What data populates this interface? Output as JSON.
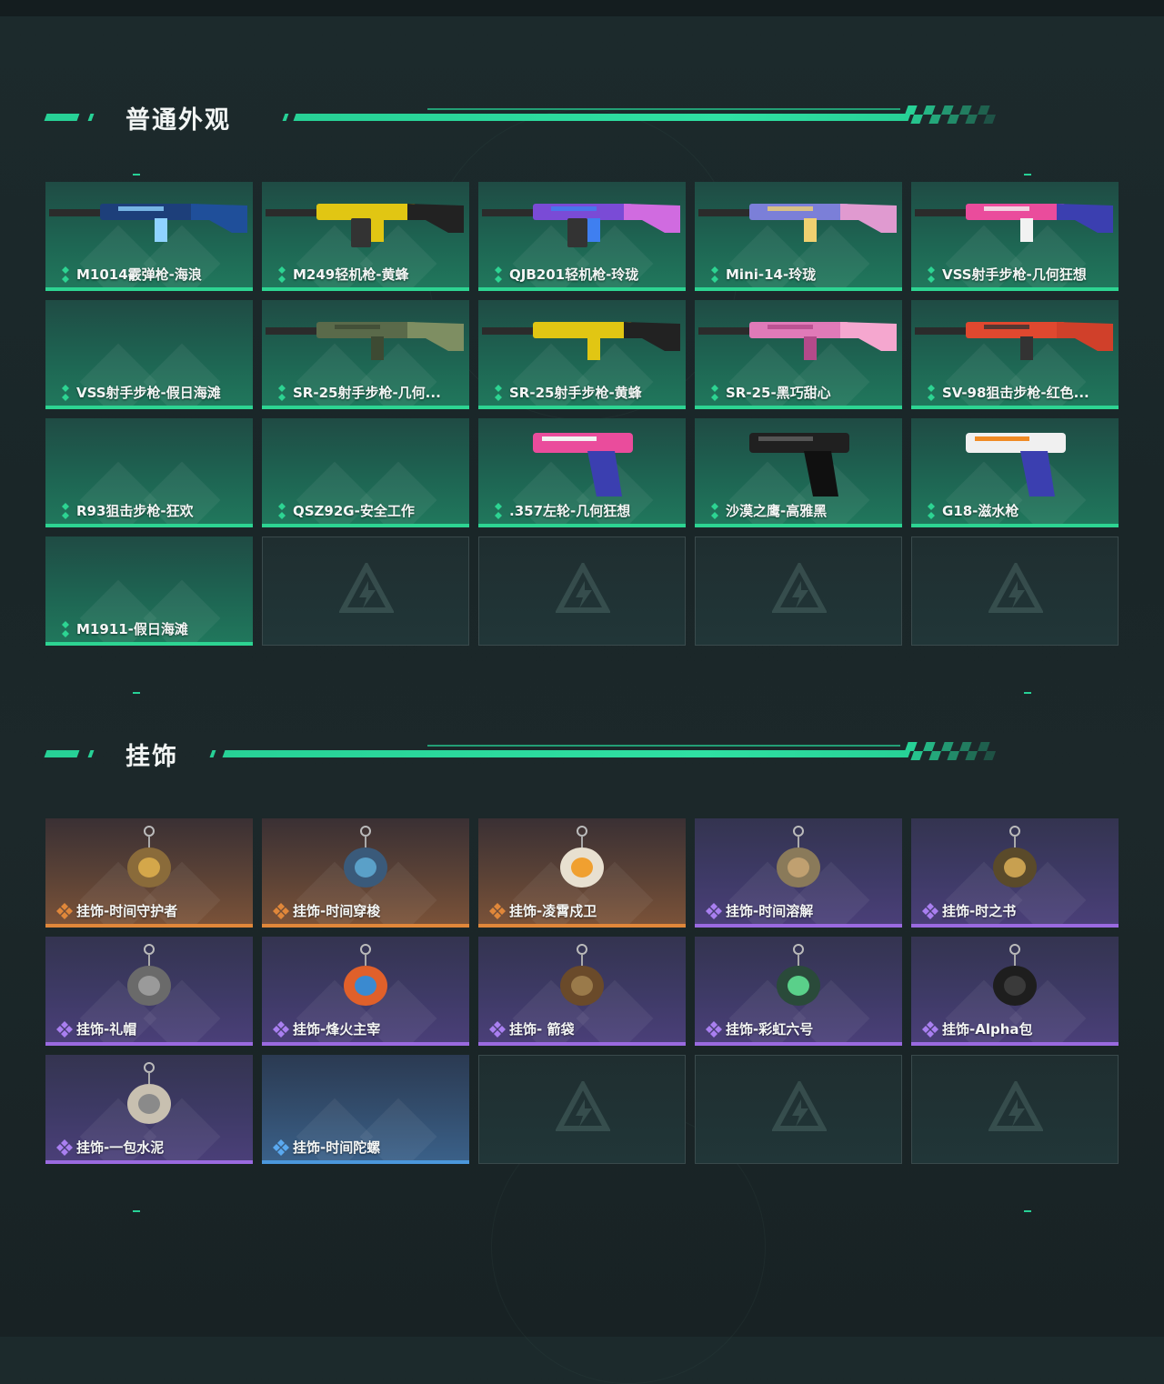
{
  "sections": {
    "skins": {
      "title": "普通外观",
      "items": [
        {
          "label": "M1014霰弹枪-海浪",
          "rarity": "green",
          "icon": "shotgun-icon"
        },
        {
          "label": "M249轻机枪-黄蜂",
          "rarity": "green",
          "icon": "machine-gun-icon"
        },
        {
          "label": "QJB201轻机枪-玲珑",
          "rarity": "green",
          "icon": "machine-gun-icon"
        },
        {
          "label": "Mini-14-玲珑",
          "rarity": "green",
          "icon": "rifle-icon"
        },
        {
          "label": "VSS射手步枪-几何狂想",
          "rarity": "green",
          "icon": "rifle-icon"
        },
        {
          "label": "VSS射手步枪-假日海滩",
          "rarity": "green",
          "icon": ""
        },
        {
          "label": "SR-25射手步枪-几何...",
          "rarity": "green",
          "icon": "rifle-icon"
        },
        {
          "label": "SR-25射手步枪-黄蜂",
          "rarity": "green",
          "icon": "rifle-icon"
        },
        {
          "label": "SR-25-黑巧甜心",
          "rarity": "green",
          "icon": "rifle-icon"
        },
        {
          "label": "SV-98狙击步枪-红色...",
          "rarity": "green",
          "icon": "sniper-icon"
        },
        {
          "label": "R93狙击步枪-狂欢",
          "rarity": "green",
          "icon": ""
        },
        {
          "label": "QSZ92G-安全工作",
          "rarity": "green",
          "icon": ""
        },
        {
          "label": ".357左轮-几何狂想",
          "rarity": "green",
          "icon": "revolver-icon"
        },
        {
          "label": "沙漠之鹰-高雅黑",
          "rarity": "green",
          "icon": "pistol-icon"
        },
        {
          "label": "G18-滋水枪",
          "rarity": "green",
          "icon": "water-pistol-icon"
        },
        {
          "label": "M1911-假日海滩",
          "rarity": "green",
          "icon": ""
        }
      ]
    },
    "charms": {
      "title": "挂饰",
      "items": [
        {
          "label": "挂饰-时间守护者",
          "rarity": "orange",
          "icon": "charm-icon"
        },
        {
          "label": "挂饰-时间穿梭",
          "rarity": "orange",
          "icon": "charm-icon"
        },
        {
          "label": "挂饰-凌霄戍卫",
          "rarity": "orange",
          "icon": "charm-icon"
        },
        {
          "label": "挂饰-时间溶解",
          "rarity": "purple",
          "icon": "charm-icon"
        },
        {
          "label": "挂饰-时之书",
          "rarity": "purple",
          "icon": "charm-icon"
        },
        {
          "label": "挂饰-礼帽",
          "rarity": "purple",
          "icon": "hat-charm-icon"
        },
        {
          "label": "挂饰-烽火主宰",
          "rarity": "purple",
          "icon": "container-charm-icon"
        },
        {
          "label": "挂饰- 箭袋",
          "rarity": "purple",
          "icon": "quiver-charm-icon"
        },
        {
          "label": "挂饰-彩虹六号",
          "rarity": "purple",
          "icon": "rainbow-six-charm-icon"
        },
        {
          "label": "挂饰-Alpha包",
          "rarity": "purple",
          "icon": "pack-charm-icon"
        },
        {
          "label": "挂饰-一包水泥",
          "rarity": "purple",
          "icon": "cement-bag-charm-icon"
        },
        {
          "label": "挂饰-时间陀螺",
          "rarity": "blue",
          "icon": ""
        }
      ]
    }
  },
  "colors": {
    "accent": "#27d196",
    "orange": "#e0873a",
    "purple": "#9a6ae0",
    "blue": "#4b97dc"
  }
}
